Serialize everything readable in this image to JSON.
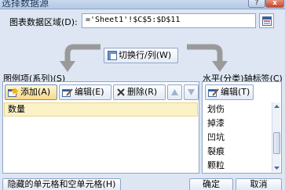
{
  "window": {
    "title": "选择数据源",
    "help_glyph": "?",
    "close_glyph": "x"
  },
  "data_range": {
    "label": "图表数据区域(D):",
    "value": "='Sheet1'!$C$5:$D$11"
  },
  "switch_button": {
    "label": "切换行/列(W)"
  },
  "legend": {
    "label": "图例项(系列)(S)",
    "add_label": "添加(A)",
    "edit_label": "编辑(E)",
    "delete_label": "删除(R)",
    "series": [
      "数量"
    ]
  },
  "axis": {
    "label": "水平(分类)轴标签(C)",
    "edit_label": "编辑(T)",
    "categories": [
      "划伤",
      "掉漆",
      "凹坑",
      "裂痕",
      "颗粒"
    ]
  },
  "footer": {
    "hidden_cells_label": "隐藏的单元格和空单元格(H)",
    "ok_label": "确定",
    "cancel_label": "取消"
  },
  "colors": {
    "background": "#dde6f2",
    "border": "#8ea6c8",
    "selection": "#fbf2c7",
    "arrow": "#9a9a9a"
  }
}
